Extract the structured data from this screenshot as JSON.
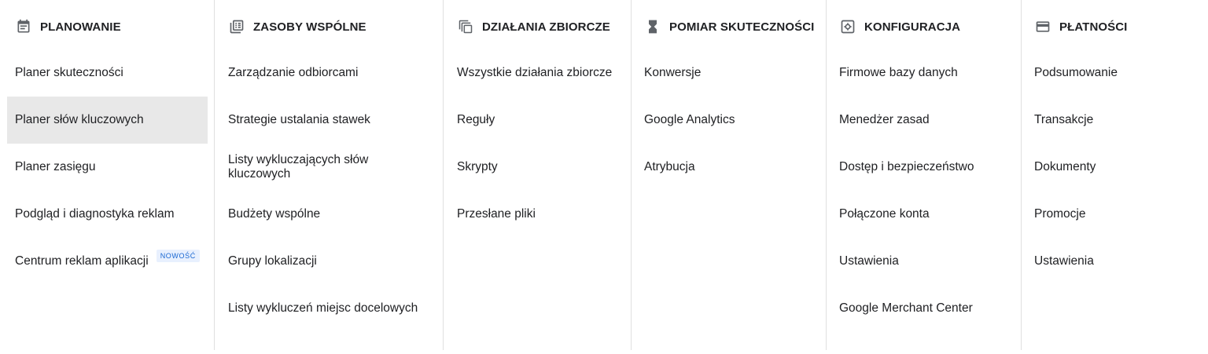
{
  "columns": [
    {
      "title": "PLANOWANIE",
      "icon": "calendar-icon",
      "items": [
        {
          "label": "Planer skuteczności"
        },
        {
          "label": "Planer słów kluczowych",
          "selected": true
        },
        {
          "label": "Planer zasięgu"
        },
        {
          "label": "Podgląd i diagnostyka reklam"
        },
        {
          "label": "Centrum reklam aplikacji",
          "badge": "NOWOŚĆ"
        }
      ]
    },
    {
      "title": "ZASOBY WSPÓLNE",
      "icon": "library-icon",
      "items": [
        {
          "label": "Zarządzanie odbiorcami"
        },
        {
          "label": "Strategie ustalania stawek"
        },
        {
          "label": "Listy wykluczających słów kluczowych"
        },
        {
          "label": "Budżety wspólne"
        },
        {
          "label": "Grupy lokalizacji"
        },
        {
          "label": "Listy wykluczeń miejsc docelowych"
        }
      ]
    },
    {
      "title": "DZIAŁANIA ZBIORCZE",
      "icon": "copy-layers-icon",
      "items": [
        {
          "label": "Wszystkie działania zbiorcze"
        },
        {
          "label": "Reguły"
        },
        {
          "label": "Skrypty"
        },
        {
          "label": "Przesłane pliki"
        }
      ]
    },
    {
      "title": "POMIAR SKUTECZNOŚCI",
      "icon": "hourglass-icon",
      "items": [
        {
          "label": "Konwersje"
        },
        {
          "label": "Google Analytics"
        },
        {
          "label": "Atrybucja"
        }
      ]
    },
    {
      "title": "KONFIGURACJA",
      "icon": "settings-box-icon",
      "items": [
        {
          "label": "Firmowe bazy danych"
        },
        {
          "label": "Menedżer zasad"
        },
        {
          "label": "Dostęp i bezpieczeństwo"
        },
        {
          "label": "Połączone konta"
        },
        {
          "label": "Ustawienia"
        },
        {
          "label": "Google Merchant Center"
        }
      ]
    },
    {
      "title": "PŁATNOŚCI",
      "icon": "credit-card-icon",
      "items": [
        {
          "label": "Podsumowanie"
        },
        {
          "label": "Transakcje"
        },
        {
          "label": "Dokumenty"
        },
        {
          "label": "Promocje"
        },
        {
          "label": "Ustawienia"
        }
      ]
    }
  ],
  "colors": {
    "text": "#202124",
    "icon": "#5f6368",
    "selected_bg": "#e8e8e8",
    "divider": "#e0e0e0",
    "badge_bg": "#e8f0fe",
    "badge_text": "#1967d2"
  }
}
